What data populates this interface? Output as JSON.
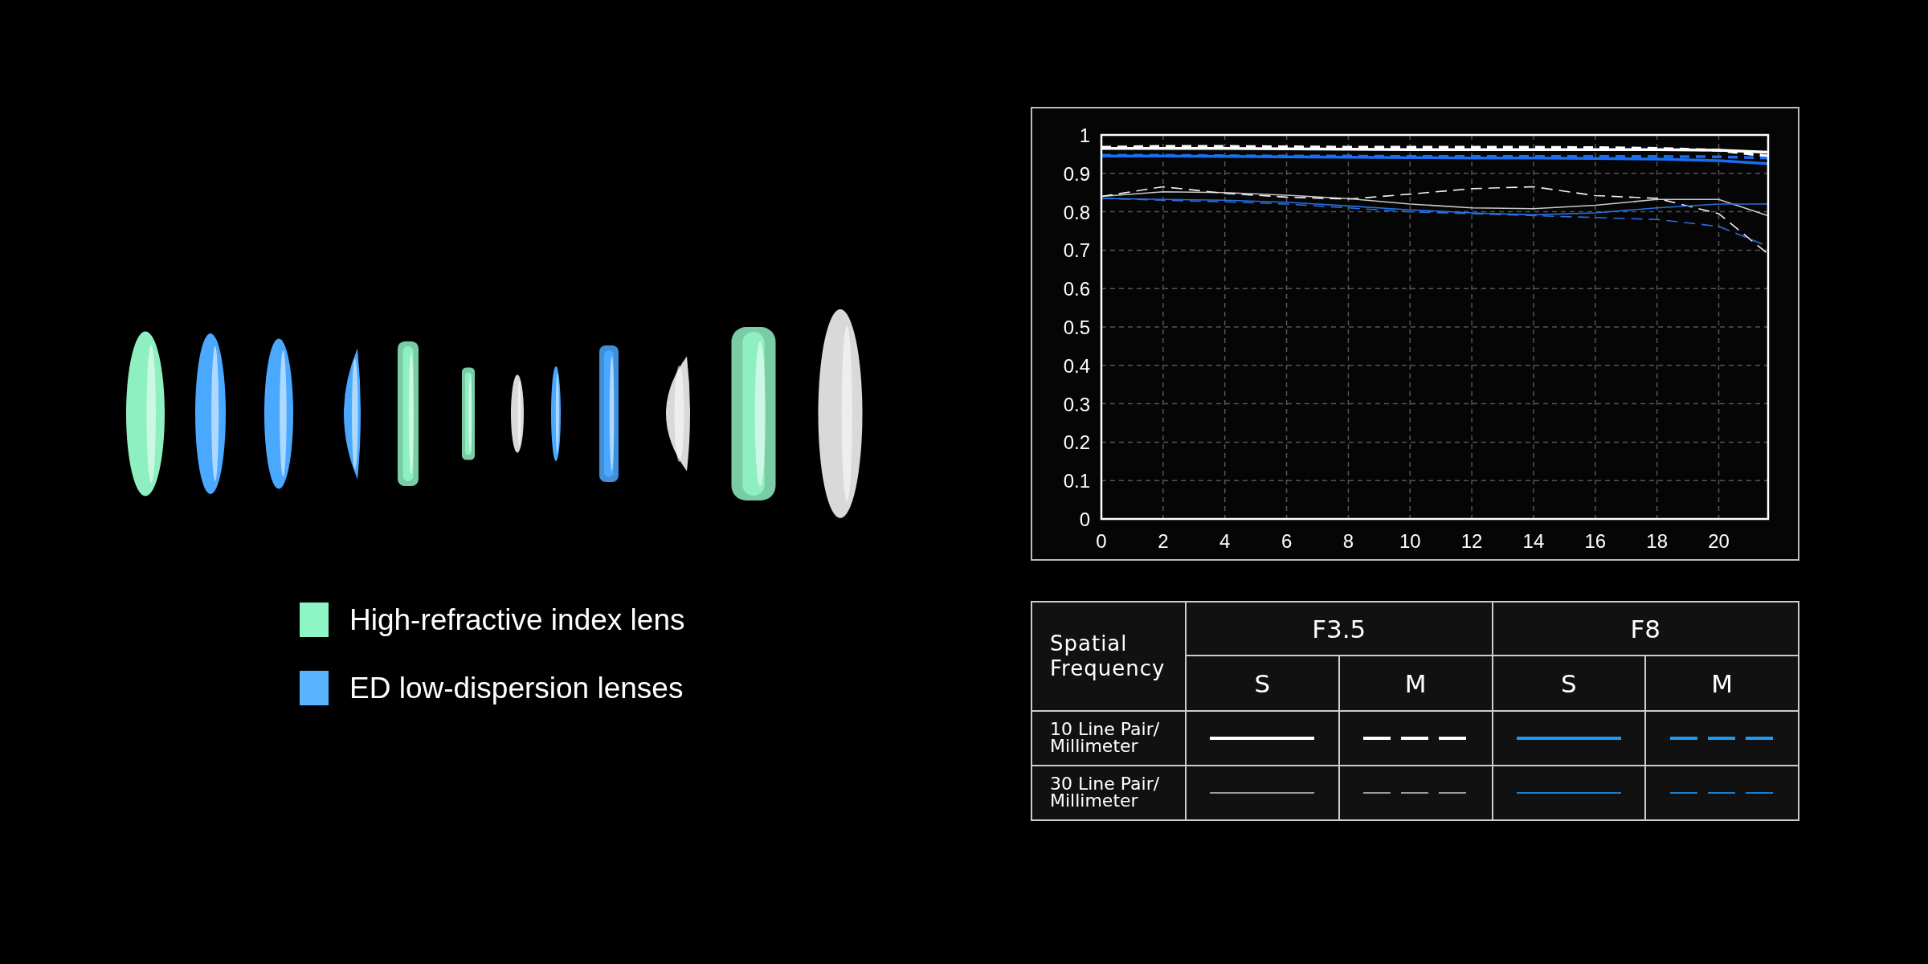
{
  "lenses": [
    {
      "color": "#8ef0c0"
    },
    {
      "color": "#4aa8ff"
    },
    {
      "color": "#4aa8ff"
    },
    {
      "color": "#4aa8ff"
    },
    {
      "color": "#8ef0c0"
    },
    {
      "color": "#8ef0c0"
    },
    {
      "color": "#d9d9d9"
    },
    {
      "color": "#4aa8ff"
    },
    {
      "color": "#4aa8ff"
    },
    {
      "color": "#d9d9d9"
    },
    {
      "color": "#8ef0c0"
    },
    {
      "color": "#d9d9d9"
    }
  ],
  "legend": [
    {
      "label": "High-refractive index lens",
      "color": "#8ef5c4"
    },
    {
      "label": "ED low-dispersion lenses",
      "color": "#5ab4ff"
    }
  ],
  "chart": {
    "chart_data": {
      "type": "line",
      "grid": true,
      "xlim": [
        0,
        21.6
      ],
      "ylim": [
        0,
        1
      ],
      "xticks": [
        0,
        2,
        4,
        6,
        8,
        10,
        12,
        14,
        16,
        18,
        20
      ],
      "yticks": [
        0,
        0.1,
        0.2,
        0.3,
        0.4,
        0.5,
        0.6,
        0.7,
        0.8,
        0.9,
        1
      ],
      "x": [
        0,
        2,
        4,
        6,
        8,
        10,
        12,
        14,
        16,
        18,
        20,
        21.6
      ],
      "series": [
        {
          "color": "#ffffff",
          "line_style": "solid",
          "values": [
            0.965,
            0.965,
            0.965,
            0.964,
            0.963,
            0.962,
            0.962,
            0.962,
            0.962,
            0.962,
            0.96,
            0.955
          ]
        },
        {
          "color": "#ffffff",
          "line_style": "dashed",
          "values": [
            0.968,
            0.97,
            0.97,
            0.969,
            0.968,
            0.968,
            0.968,
            0.968,
            0.967,
            0.965,
            0.96,
            0.945
          ]
        },
        {
          "color": "#1a6ff0",
          "line_style": "solid",
          "values": [
            0.945,
            0.945,
            0.944,
            0.943,
            0.942,
            0.941,
            0.94,
            0.94,
            0.939,
            0.937,
            0.933,
            0.925
          ]
        },
        {
          "color": "#1a6ff0",
          "line_style": "dashed",
          "values": [
            0.947,
            0.947,
            0.946,
            0.945,
            0.945,
            0.944,
            0.944,
            0.944,
            0.944,
            0.944,
            0.943,
            0.94
          ]
        },
        {
          "color": "#c8c8c8",
          "line_style": "solid",
          "values": [
            0.84,
            0.852,
            0.85,
            0.843,
            0.834,
            0.82,
            0.81,
            0.808,
            0.817,
            0.832,
            0.832,
            0.79
          ]
        },
        {
          "color": "#f0f0f0",
          "line_style": "dashed",
          "values": [
            0.84,
            0.865,
            0.848,
            0.838,
            0.833,
            0.846,
            0.86,
            0.865,
            0.842,
            0.835,
            0.795,
            0.69
          ]
        },
        {
          "color": "#2a70e0",
          "line_style": "solid",
          "values": [
            0.835,
            0.832,
            0.83,
            0.825,
            0.815,
            0.805,
            0.797,
            0.792,
            0.797,
            0.81,
            0.82,
            0.82
          ]
        },
        {
          "color": "#2a70e0",
          "line_style": "dashed",
          "values": [
            0.835,
            0.83,
            0.826,
            0.82,
            0.81,
            0.8,
            0.795,
            0.79,
            0.785,
            0.78,
            0.762,
            0.71
          ]
        }
      ]
    }
  },
  "table": {
    "corner": "Spatial\nFrequency",
    "groups": [
      "F3.5",
      "F8"
    ],
    "subheads": [
      "S",
      "M",
      "S",
      "M"
    ],
    "rows": [
      {
        "label": "10 Line Pair/\nMillimeter",
        "kind": "thick",
        "swatches": [
          {
            "color": "#ffffff",
            "dashed": false
          },
          {
            "color": "#ffffff",
            "dashed": true
          },
          {
            "color": "#1e9bf0",
            "dashed": false
          },
          {
            "color": "#1e9bf0",
            "dashed": true
          }
        ]
      },
      {
        "label": "30 Line Pair/\nMillimeter",
        "kind": "thin",
        "swatches": [
          {
            "color": "#9a9a9a",
            "dashed": false
          },
          {
            "color": "#9a9a9a",
            "dashed": true
          },
          {
            "color": "#1a7fd0",
            "dashed": false
          },
          {
            "color": "#1a7fd0",
            "dashed": true
          }
        ]
      }
    ]
  }
}
